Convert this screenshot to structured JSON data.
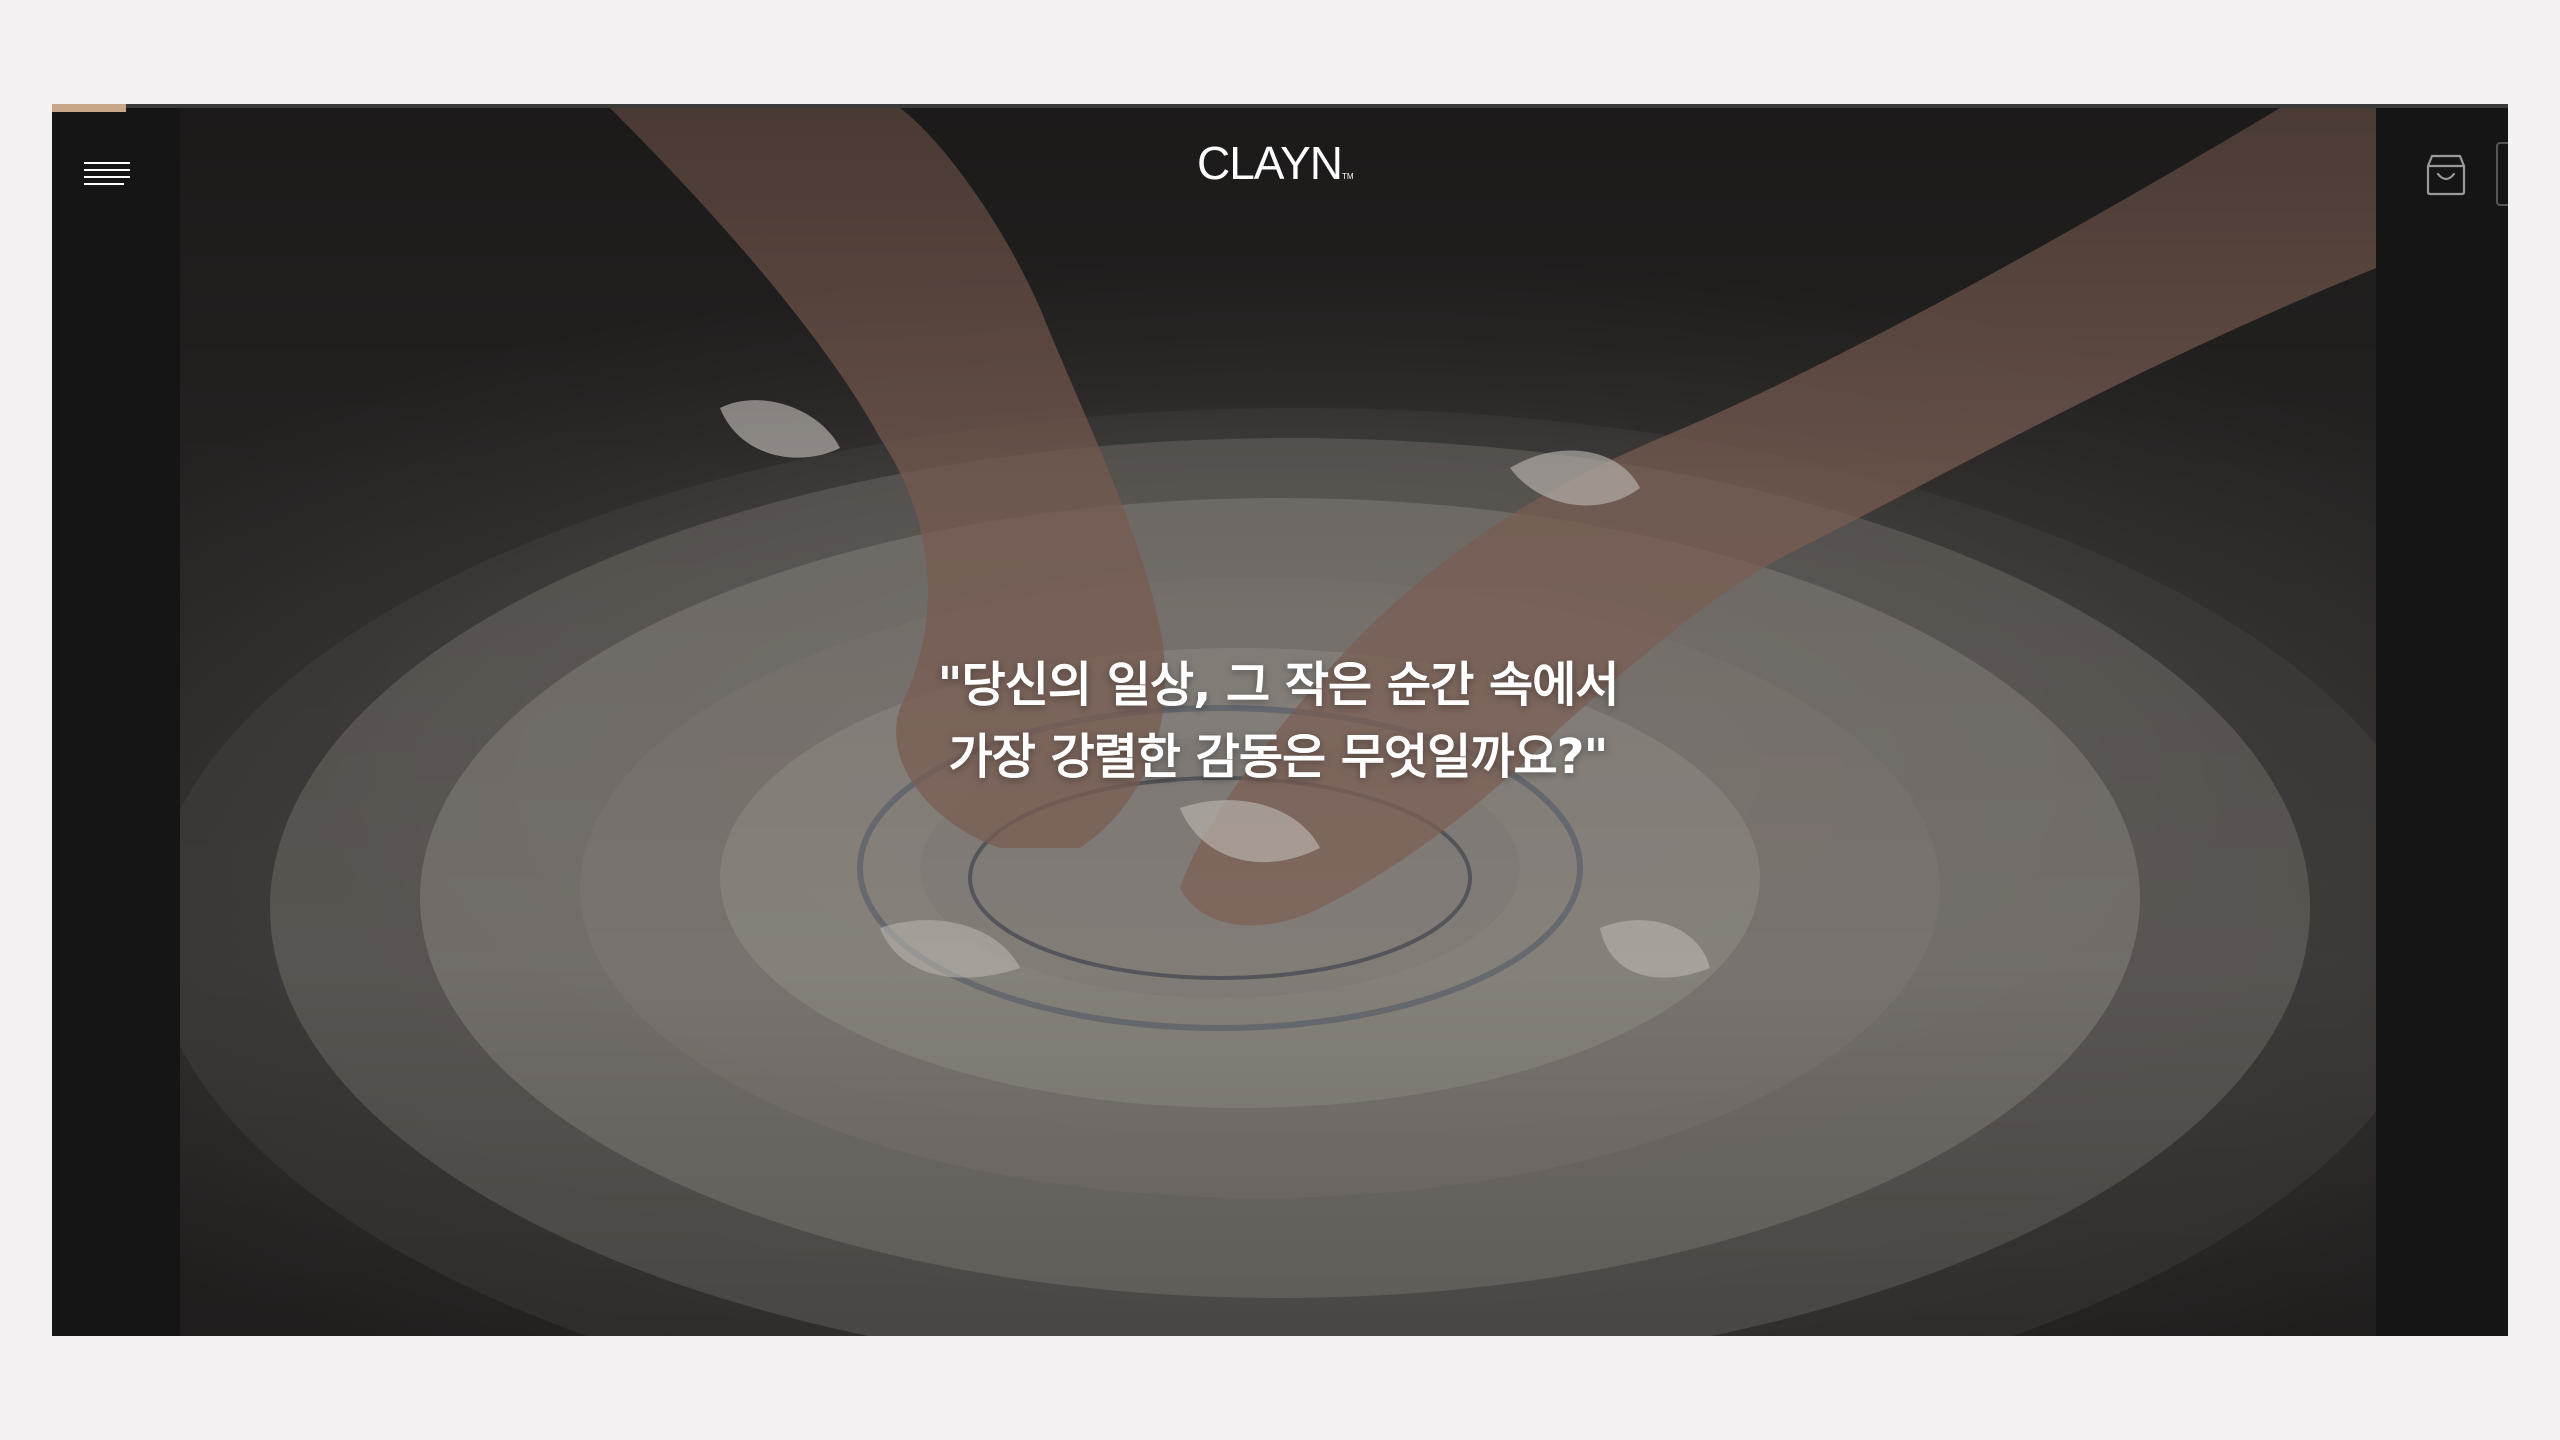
{
  "header": {
    "logo": "CLAYN",
    "logo_mark": "TM",
    "menu_icon": "hamburger-icon",
    "cart_icon": "shopping-bag-icon"
  },
  "hero": {
    "image_subject": "hands shaping clay on pottery wheel",
    "quote_line1": "\"당신의 일상, 그 작은 순간 속에서",
    "quote_line2": "가장 강렬한 감동은 무엇일까요?\""
  },
  "progress": {
    "value": 0.03
  },
  "colors": {
    "page_background": "#f5f0f1",
    "frame_background": "#151515",
    "progress_accent": "#c8a68a",
    "text": "#ffffff"
  }
}
